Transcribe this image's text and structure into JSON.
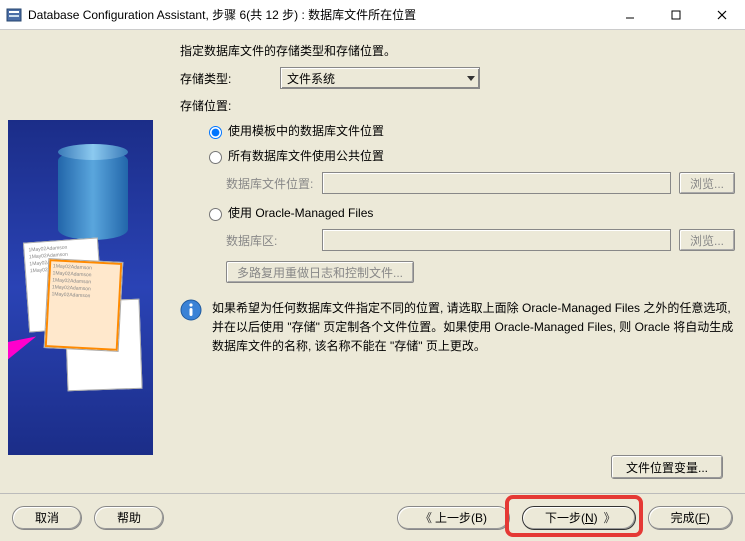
{
  "window": {
    "title": "Database Configuration Assistant, 步骤 6(共 12 步) : 数据库文件所在位置"
  },
  "main": {
    "intro": "指定数据库文件的存储类型和存储位置。",
    "storageTypeLabel": "存储类型:",
    "storageTypeValue": "文件系统",
    "storageLocationLabel": "存储位置:",
    "radios": {
      "useTemplate": "使用模板中的数据库文件位置",
      "useCommon": "所有数据库文件使用公共位置",
      "useOMF": "使用 Oracle-Managed Files"
    },
    "dbFileLocationLabel": "数据库文件位置:",
    "dbAreaLabel": "数据库区:",
    "browse": "浏览...",
    "multiplexButton": "多路复用重做日志和控制文件...",
    "infoText": "如果希望为任何数据库文件指定不同的位置, 请选取上面除 Oracle-Managed Files 之外的任意选项, 并在以后使用 \"存储\" 页定制各个文件位置。如果使用 Oracle-Managed Files, 则 Oracle 将自动生成数据库文件的名称, 该名称不能在 \"存储\" 页上更改。",
    "fileVarButton": "文件位置变量..."
  },
  "footer": {
    "cancel": "取消",
    "help": "帮助",
    "back": "上一步(B)",
    "next": "下一步(N)",
    "finish": "完成(F)"
  }
}
